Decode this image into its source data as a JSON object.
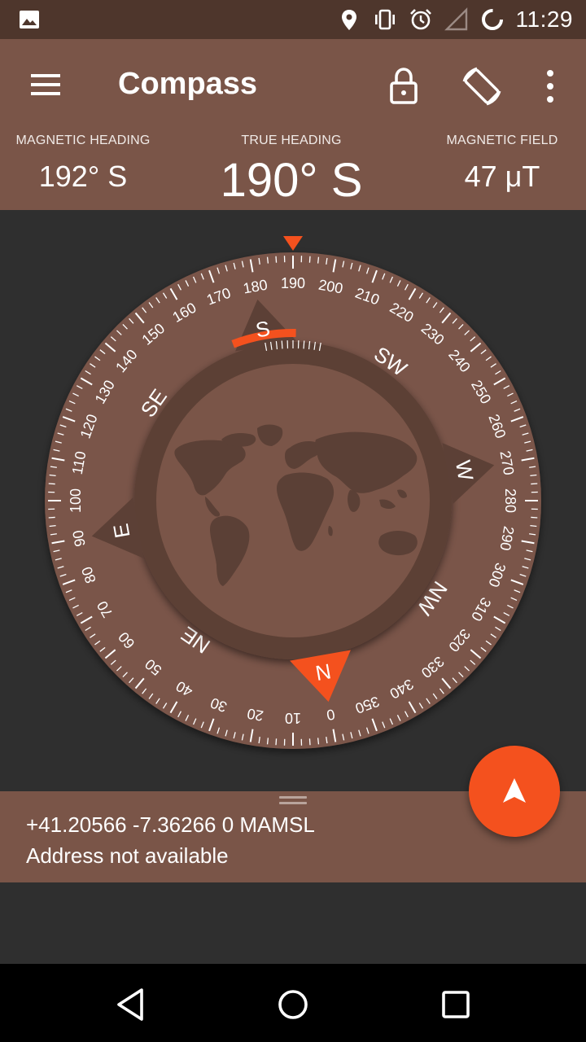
{
  "status_bar": {
    "time": "11:29",
    "icons": [
      "image-icon",
      "location-icon",
      "vibrate-icon",
      "alarm-icon",
      "signal-icon",
      "sync-icon"
    ]
  },
  "app_bar": {
    "title": "Compass",
    "icons": [
      "menu-icon",
      "lock-icon",
      "screen-rotation-icon",
      "more-vert-icon"
    ]
  },
  "headings": {
    "magnetic_label": "MAGNETIC HEADING",
    "magnetic_value": "192° S",
    "true_label": "TRUE HEADING",
    "true_value": "190° S",
    "field_label": "MAGNETIC FIELD",
    "field_value": "47 μT"
  },
  "compass": {
    "heading_deg": 190,
    "degree_labels": [
      "0",
      "10",
      "20",
      "30",
      "40",
      "50",
      "60",
      "70",
      "80",
      "90",
      "100",
      "110",
      "120",
      "130",
      "140",
      "150",
      "160",
      "170",
      "180",
      "190",
      "200",
      "210",
      "220",
      "230",
      "240",
      "250",
      "260",
      "270",
      "280",
      "290",
      "300",
      "310",
      "320",
      "330",
      "340",
      "350"
    ],
    "cardinals": [
      {
        "label": "N",
        "bearing": 0
      },
      {
        "label": "E",
        "bearing": 90
      },
      {
        "label": "S",
        "bearing": 180
      },
      {
        "label": "W",
        "bearing": 270
      }
    ],
    "intercardinals": [
      {
        "label": "NE",
        "bearing": 45
      },
      {
        "label": "SE",
        "bearing": 135
      },
      {
        "label": "SW",
        "bearing": 225
      },
      {
        "label": "NW",
        "bearing": 315
      }
    ],
    "colors": {
      "dial": "#7a5548",
      "ring": "#5c4036",
      "globe": "#7a5548",
      "land": "#5b4036",
      "accent": "#f4511e",
      "text": "#ffffff"
    }
  },
  "location": {
    "coords": "+41.20566 -7.36266 0 MAMSL",
    "address": "Address not available"
  },
  "fab": {
    "icon": "navigation-arrow-icon"
  },
  "nav_bar": {
    "icons": [
      "back-icon",
      "home-icon",
      "recents-icon"
    ]
  }
}
